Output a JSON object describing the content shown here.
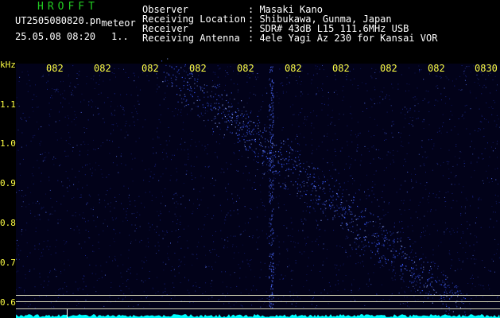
{
  "header": {
    "brand": "HROFFT",
    "filename": "UT2505080820.pn",
    "filename_suffix": "meteor",
    "datetime": "25.05.08 08:20",
    "counter": "1..",
    "fields": [
      {
        "label": "Observer",
        "value": "Masaki Kano"
      },
      {
        "label": "Receiving Location",
        "value": "Shibukawa, Gunma, Japan"
      },
      {
        "label": "Receiver",
        "value": "SDR# 43dB L15 111.6MHz USB"
      },
      {
        "label": "Receiving Antenna",
        "value": "4ele Yagi Az 230 for Kansai VOR"
      }
    ]
  },
  "plot": {
    "y_unit": "kHz",
    "x_ticks": [
      "082",
      "082",
      "082",
      "082",
      "082",
      "082",
      "082",
      "082",
      "082",
      "0830"
    ],
    "y_ticks": [
      "1.1",
      "1.0",
      "0.9",
      "0.8",
      "0.7",
      "0.6"
    ],
    "colors": {
      "background": "#020219",
      "signal": "#3b5cff",
      "label": "#ffff44",
      "baseline": "#00ffff"
    }
  }
}
